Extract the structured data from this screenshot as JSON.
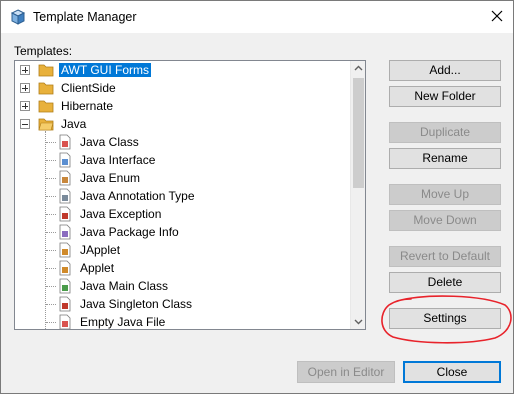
{
  "window": {
    "title": "Template Manager"
  },
  "templates_label": "Templates:",
  "tree": {
    "folders": [
      {
        "label": "AWT GUI Forms",
        "expanded": false,
        "selected": true
      },
      {
        "label": "ClientSide",
        "expanded": false,
        "selected": false
      },
      {
        "label": "Hibernate",
        "expanded": false,
        "selected": false
      },
      {
        "label": "Java",
        "expanded": true,
        "selected": false
      }
    ],
    "java_children": [
      {
        "label": "Java Class",
        "icon": "java-class-icon"
      },
      {
        "label": "Java Interface",
        "icon": "java-interface-icon"
      },
      {
        "label": "Java Enum",
        "icon": "java-enum-icon"
      },
      {
        "label": "Java Annotation Type",
        "icon": "java-annotation-icon"
      },
      {
        "label": "Java Exception",
        "icon": "java-exception-icon"
      },
      {
        "label": "Java Package Info",
        "icon": "java-package-info-icon"
      },
      {
        "label": "JApplet",
        "icon": "japplet-icon"
      },
      {
        "label": "Applet",
        "icon": "applet-icon"
      },
      {
        "label": "Java Main Class",
        "icon": "java-main-class-icon"
      },
      {
        "label": "Java Singleton Class",
        "icon": "java-singleton-icon"
      },
      {
        "label": "Empty Java File",
        "icon": "empty-java-file-icon"
      }
    ]
  },
  "buttons": {
    "add": "Add...",
    "new_folder": "New Folder",
    "duplicate": "Duplicate",
    "rename": "Rename",
    "move_up": "Move Up",
    "move_down": "Move Down",
    "revert_to_default": "Revert to Default",
    "delete": "Delete",
    "settings": "Settings",
    "open_in_editor": "Open in Editor",
    "close": "Close"
  },
  "colors": {
    "selection": "#0078d7",
    "annotation": "#e8232b",
    "folder": "#e8b13c"
  }
}
